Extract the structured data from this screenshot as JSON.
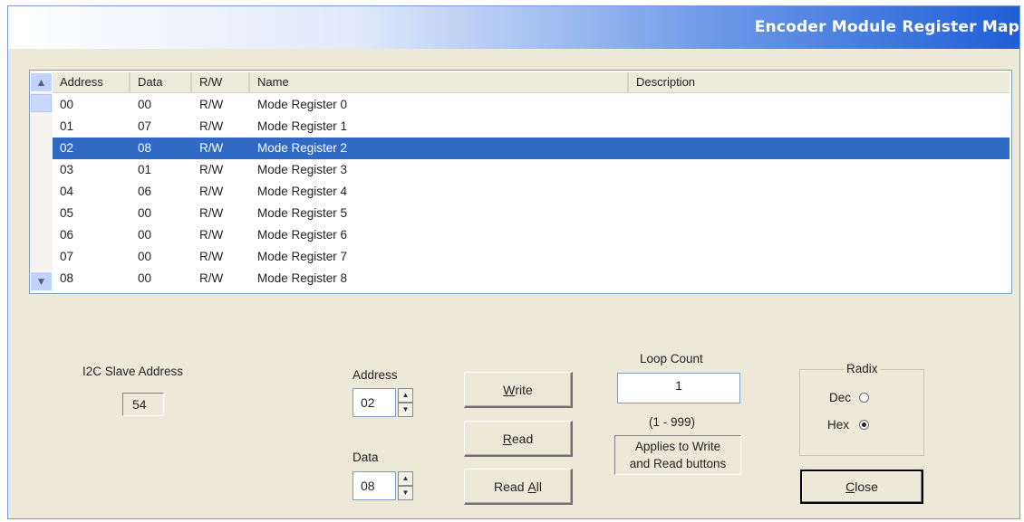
{
  "window": {
    "title": "Encoder Module Register Map"
  },
  "register_list": {
    "columns": [
      "Address",
      "Data",
      "R/W",
      "Name",
      "Description"
    ],
    "rows": [
      {
        "address": "00",
        "data": "00",
        "rw": "R/W",
        "name": "Mode Register 0",
        "description": ""
      },
      {
        "address": "01",
        "data": "07",
        "rw": "R/W",
        "name": "Mode Register 1",
        "description": ""
      },
      {
        "address": "02",
        "data": "08",
        "rw": "R/W",
        "name": "Mode Register 2",
        "description": ""
      },
      {
        "address": "03",
        "data": "01",
        "rw": "R/W",
        "name": "Mode Register 3",
        "description": ""
      },
      {
        "address": "04",
        "data": "06",
        "rw": "R/W",
        "name": "Mode Register 4",
        "description": ""
      },
      {
        "address": "05",
        "data": "00",
        "rw": "R/W",
        "name": "Mode Register 5",
        "description": ""
      },
      {
        "address": "06",
        "data": "00",
        "rw": "R/W",
        "name": "Mode Register 6",
        "description": ""
      },
      {
        "address": "07",
        "data": "00",
        "rw": "R/W",
        "name": "Mode Register 7",
        "description": ""
      },
      {
        "address": "08",
        "data": "00",
        "rw": "R/W",
        "name": "Mode Register 8",
        "description": ""
      }
    ],
    "selected_index": 2,
    "scroll_up_icon": "chevron-up-icon",
    "scroll_down_icon": "chevron-down-icon"
  },
  "i2c": {
    "label": "I2C Slave Address",
    "value": "54"
  },
  "address": {
    "label": "Address",
    "value": "02"
  },
  "data_field": {
    "label": "Data",
    "value": "08"
  },
  "buttons": {
    "write_pre": "",
    "write_u": "W",
    "write_post": "rite",
    "read_pre": "",
    "read_u": "R",
    "read_post": "ead",
    "readall_pre": "Read ",
    "readall_u": "A",
    "readall_post": "ll",
    "close_pre": "",
    "close_u": "C",
    "close_post": "lose"
  },
  "loop_count": {
    "label": "Loop Count",
    "value": "1",
    "range": "(1 - 999)",
    "note_line1": "Applies to Write",
    "note_line2": "and Read buttons"
  },
  "radix": {
    "label": "Radix",
    "options": [
      {
        "label": "Dec",
        "selected": false
      },
      {
        "label": "Hex",
        "selected": true
      }
    ]
  }
}
